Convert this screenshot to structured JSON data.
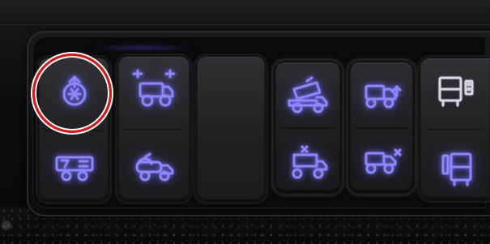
{
  "scene": {
    "description_free": true,
    "accent_glow": "#7f78ff",
    "highlight_circle": "#d51b1b"
  },
  "switches": [
    {
      "name": "switch-defrost",
      "top_icon": "defrost-icon",
      "bottom_icon": "trailer-lift-icon",
      "highlighted": true
    },
    {
      "name": "switch-axle",
      "top_icon": "axle-lock-icon",
      "bottom_icon": "tanker-icon",
      "highlighted": false
    },
    {
      "name": "switch-blank",
      "top_icon": "",
      "bottom_icon": "",
      "highlighted": false
    },
    {
      "name": "switch-dump-bed",
      "top_icon": "dump-raise-icon",
      "bottom_icon": "dump-lower-icon",
      "highlighted": false
    },
    {
      "name": "switch-tailgate",
      "top_icon": "tailgate-open-icon",
      "bottom_icon": "tailgate-close-icon",
      "highlighted": false
    },
    {
      "name": "switch-rear-lights",
      "top_icon": "rear-lights-icon",
      "bottom_icon": "bus-icon",
      "highlighted": false
    }
  ]
}
